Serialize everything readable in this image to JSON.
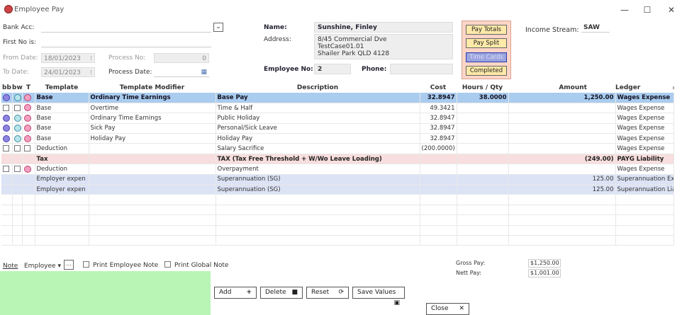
{
  "window": {
    "title": "Employee Pay",
    "minimize": "—",
    "maximize": "☐",
    "close": "✕"
  },
  "form": {
    "bank_acc_label": "Bank Acc:",
    "bank_acc_value": "",
    "first_no_label": "First No is:",
    "from_date_label": "From Date:",
    "from_date": "18/01/2023",
    "to_date_label": "To Date:",
    "to_date": "24/01/2023",
    "process_no_label": "Process No:",
    "process_no": "0",
    "process_date_label": "Process Date:",
    "name_label": "Name:",
    "name": "Sunshine, Finley",
    "address_label": "Address:",
    "address_lines": [
      "8/45 Commercial Dve",
      "TestCase01.01",
      "Shailer Park QLD 4128"
    ],
    "employee_no_label": "Employee No:",
    "employee_no": "2",
    "phone_label": "Phone:",
    "phone": "",
    "income_stream_label": "Income Stream:",
    "income_stream": "SAW"
  },
  "panel_buttons": {
    "pay_totals": "Pay Totals",
    "pay_split": "Pay Split",
    "time_cards": "Time Cards",
    "completed": "Completed"
  },
  "table": {
    "headers": {
      "bb": "bb",
      "bw": "bw",
      "t": "T",
      "template": "Template",
      "modifier": "Template Modifier",
      "description": "Description",
      "cost": "Cost",
      "hours": "Hours / Qty",
      "amount": "Amount",
      "ledger": "Ledger"
    },
    "rows": [
      {
        "template": "Base",
        "modifier": "Ordinary Time Earnings",
        "description": "Base Pay",
        "cost": "32.8947",
        "hours": "38.0000",
        "amount": "1,250.00",
        "ledger": "Wages Expense"
      },
      {
        "template": "Base",
        "modifier": "Overtime",
        "description": "Time & Half",
        "cost": "49.3421",
        "hours": "",
        "amount": "",
        "ledger": "Wages Expense"
      },
      {
        "template": "Base",
        "modifier": "Ordinary Time Earnings",
        "description": "Public Holiday",
        "cost": "32.8947",
        "hours": "",
        "amount": "",
        "ledger": "Wages Expense"
      },
      {
        "template": "Base",
        "modifier": "Sick Pay",
        "description": "Personal/Sick Leave",
        "cost": "32.8947",
        "hours": "",
        "amount": "",
        "ledger": "Wages Expense"
      },
      {
        "template": "Base",
        "modifier": "Holiday Pay",
        "description": "Holiday Pay",
        "cost": "32.8947",
        "hours": "",
        "amount": "",
        "ledger": "Wages Expense"
      },
      {
        "template": "Deduction",
        "modifier": "",
        "description": "Salary Sacrifice",
        "cost": "(200.0000)",
        "hours": "",
        "amount": "",
        "ledger": "Wages Expense"
      },
      {
        "template": "Tax",
        "modifier": "",
        "description": "TAX (Tax Free Threshold  + W/Wo Leave Loading)",
        "cost": "",
        "hours": "",
        "amount": "(249.00)",
        "ledger": "PAYG Liability"
      },
      {
        "template": "Deduction",
        "modifier": "",
        "description": "Overpayment",
        "cost": "",
        "hours": "",
        "amount": "",
        "ledger": "Wages Expense"
      },
      {
        "template": "Employer expen",
        "modifier": "",
        "description": "Superannuation (SG)",
        "cost": "",
        "hours": "",
        "amount": "125.00",
        "ledger": "Superannuation Expense"
      },
      {
        "template": "Employer expen",
        "modifier": "",
        "description": "Superannuation (SG)",
        "cost": "",
        "hours": "",
        "amount": "125.00",
        "ledger": "Superannuation Liability"
      }
    ]
  },
  "footer": {
    "note_label": "Note",
    "note_select": "Employee",
    "note_ellipsis": "...",
    "print_employee_note": "Print Employee Note",
    "print_global_note": "Print Global Note",
    "gross_pay_label": "Gross Pay:",
    "gross_pay": "$1,250.00",
    "nett_pay_label": "Nett Pay:",
    "nett_pay": "$1,001.00"
  },
  "buttons": {
    "add": "Add",
    "delete": "Delete",
    "reset": "Reset",
    "save": "Save Values",
    "close": "Close"
  },
  "colors": {
    "selected_row": "#aaccef",
    "tax_row": "#f8dede",
    "employer_row": "#dbe3f5",
    "panel": "#fcd5c6",
    "note_area": "#b9f5b4"
  }
}
